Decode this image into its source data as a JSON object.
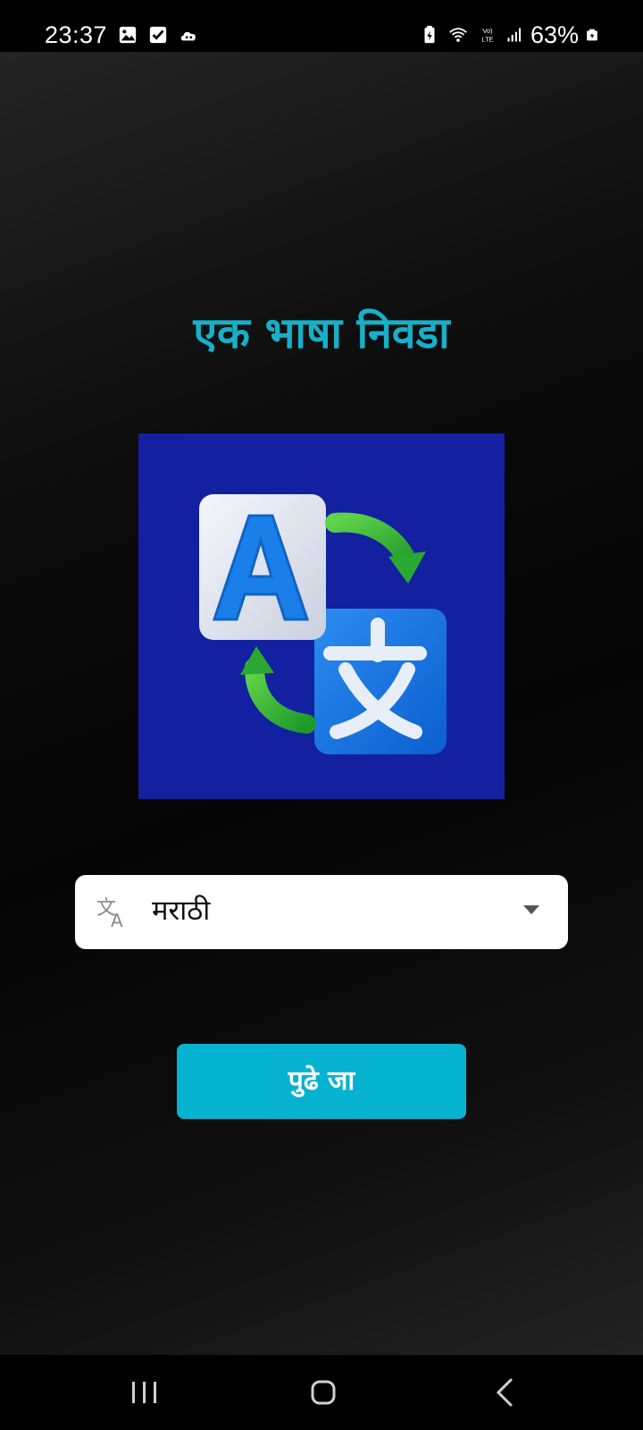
{
  "status_bar": {
    "time": "23:37",
    "battery_percent": "63%",
    "icons_left": [
      "gallery-icon",
      "check-box-icon",
      "cloud-icon"
    ],
    "icons_right": [
      "battery-saver-icon",
      "wifi-icon",
      "volte-icon",
      "signal-icon",
      "battery-icon"
    ]
  },
  "screen": {
    "title": "एक भाषा निवडा",
    "hero_image": "translate-illustration",
    "language_select": {
      "selected": "मराठी",
      "icon": "translate-icon"
    },
    "continue_label": "पुढे जा"
  },
  "nav_bar": {
    "buttons": [
      "recent-apps-icon",
      "home-icon",
      "back-icon"
    ]
  },
  "colors": {
    "accent": "#17b0c9",
    "button": "#05b3d0",
    "hero_background": "#1320a0"
  }
}
